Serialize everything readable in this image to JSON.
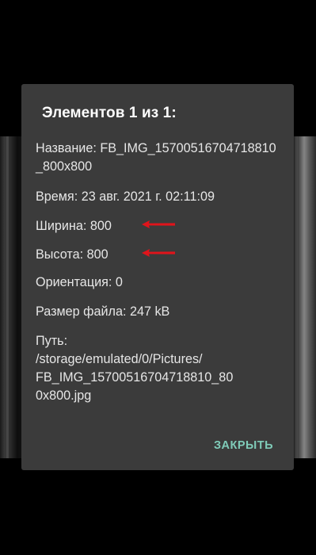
{
  "dialog": {
    "title": "Элементов 1 из 1:",
    "name_label": "Название: FB_IMG_15700516704718810_800x800",
    "time_label": "Время: 23 авг. 2021 г. 02:11:09",
    "width_label": "Ширина: 800",
    "height_label": "Высота: 800",
    "orientation_label": "Ориентация: 0",
    "filesize_label": "Размер файла: 247 kB",
    "path_lines": [
      "Путь:",
      "/storage/emulated/0/Pictures/",
      "FB_IMG_15700516704718810_80",
      "0x800.jpg"
    ],
    "close_label": "ЗАКРЫТЬ"
  },
  "colors": {
    "dialog_bg": "#3b3b3b",
    "text": "#e6e6e6",
    "accent": "#7fcbb8",
    "arrow": "#e0141b"
  },
  "icons": {
    "annotation": "red-arrow-icon"
  }
}
